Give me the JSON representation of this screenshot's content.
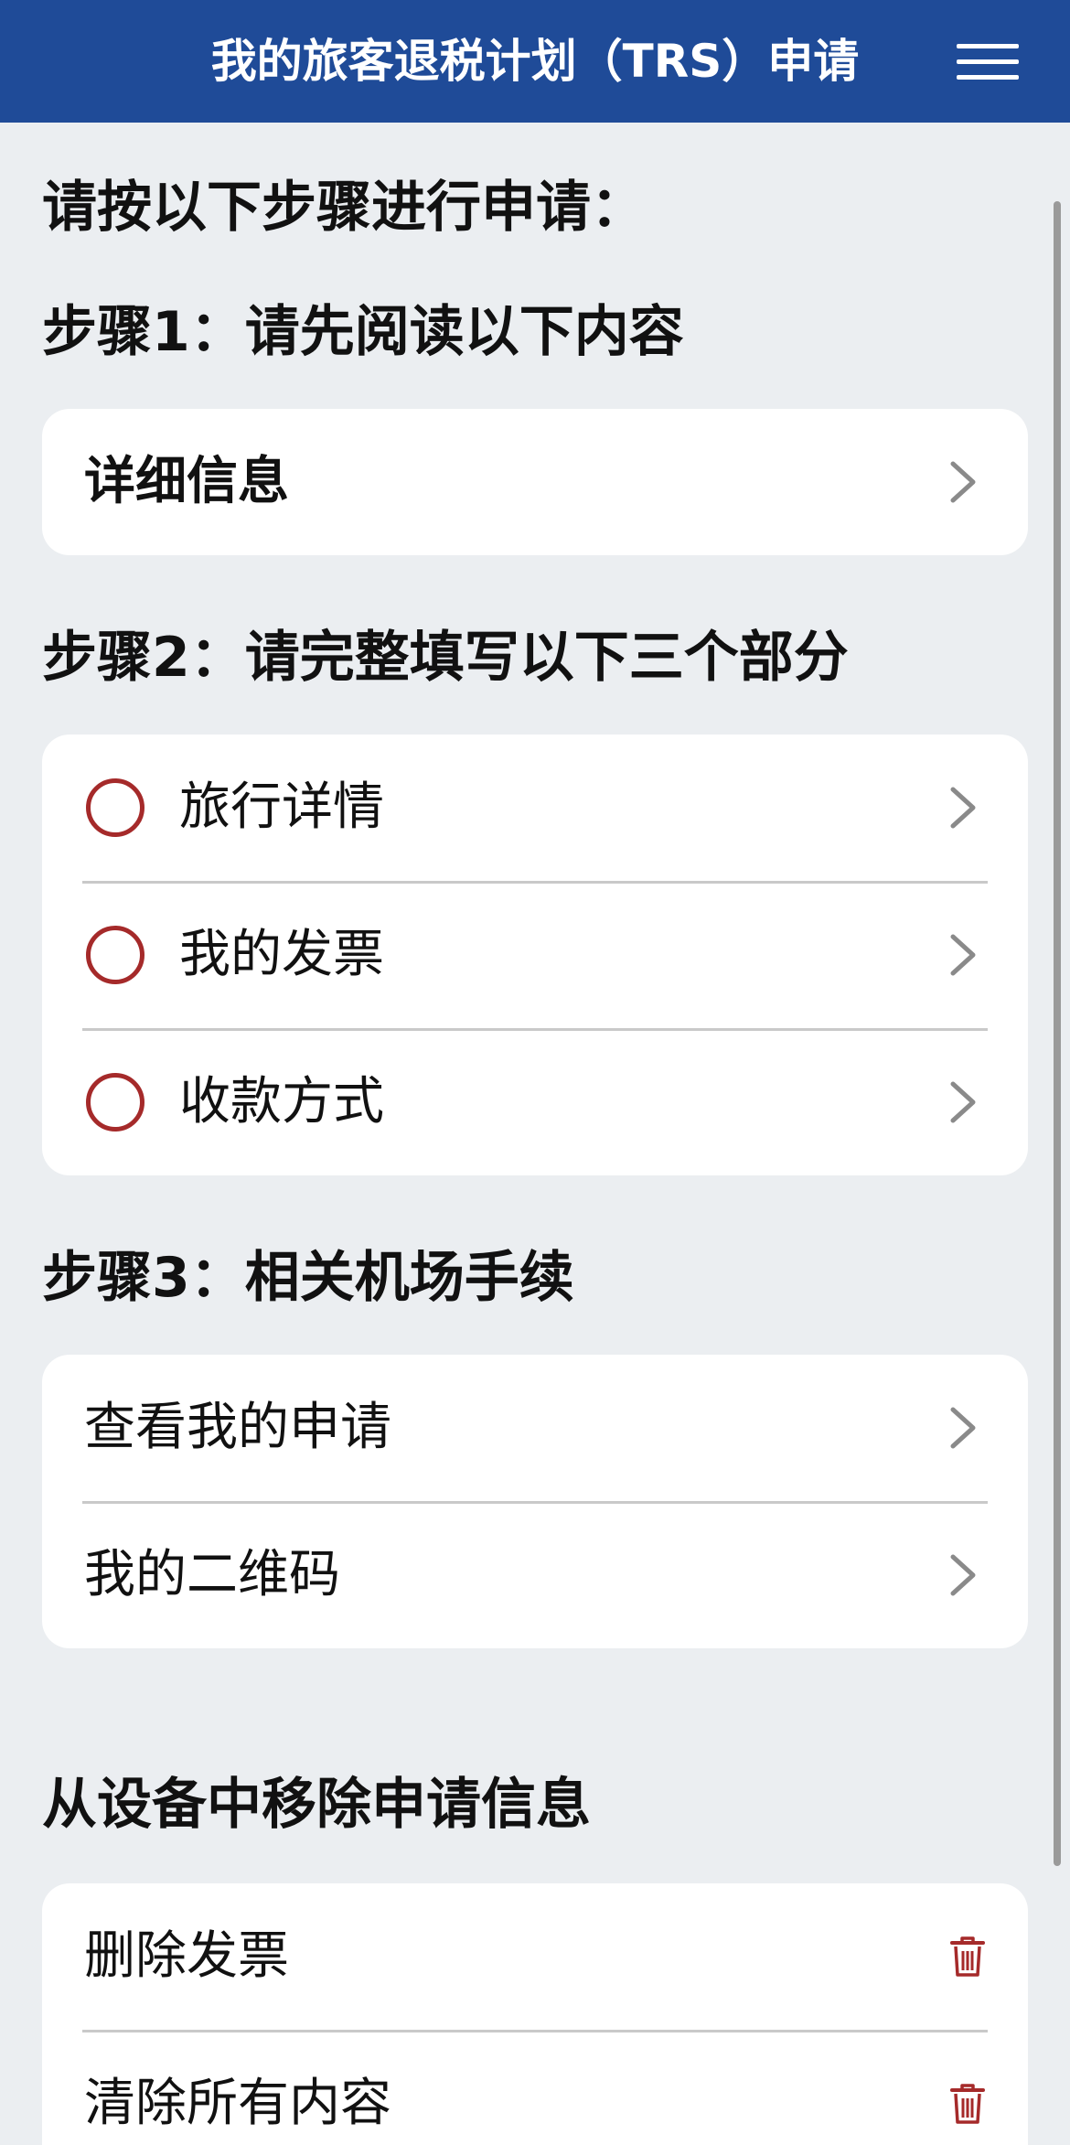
{
  "header": {
    "title": "我的旅客退税计划（TRS）申请",
    "menu_icon": "hamburger-menu-icon"
  },
  "intro": "请按以下步骤进行申请：",
  "step1": {
    "title": "步骤1：请先阅读以下内容",
    "items": [
      {
        "label": "详细信息",
        "icon": "chevron-right-icon"
      }
    ]
  },
  "step2": {
    "title": "步骤2：请完整填写以下三个部分",
    "items": [
      {
        "label": "旅行详情",
        "status_icon": "empty-circle-icon",
        "icon": "chevron-right-icon"
      },
      {
        "label": "我的发票",
        "status_icon": "empty-circle-icon",
        "icon": "chevron-right-icon"
      },
      {
        "label": "收款方式",
        "status_icon": "empty-circle-icon",
        "icon": "chevron-right-icon"
      }
    ]
  },
  "step3": {
    "title": "步骤3：相关机场手续",
    "items": [
      {
        "label": "查看我的申请",
        "icon": "chevron-right-icon"
      },
      {
        "label": "我的二维码",
        "icon": "chevron-right-icon"
      }
    ]
  },
  "remove": {
    "title": "从设备中移除申请信息",
    "items": [
      {
        "label": "删除发票",
        "icon": "trash-icon"
      },
      {
        "label": "清除所有内容",
        "icon": "trash-icon"
      }
    ]
  },
  "colors": {
    "header_bg": "#1f4b98",
    "page_bg": "#ebeef1",
    "status_red": "#a52a2a",
    "chevron_gray": "#8a8a8a"
  }
}
